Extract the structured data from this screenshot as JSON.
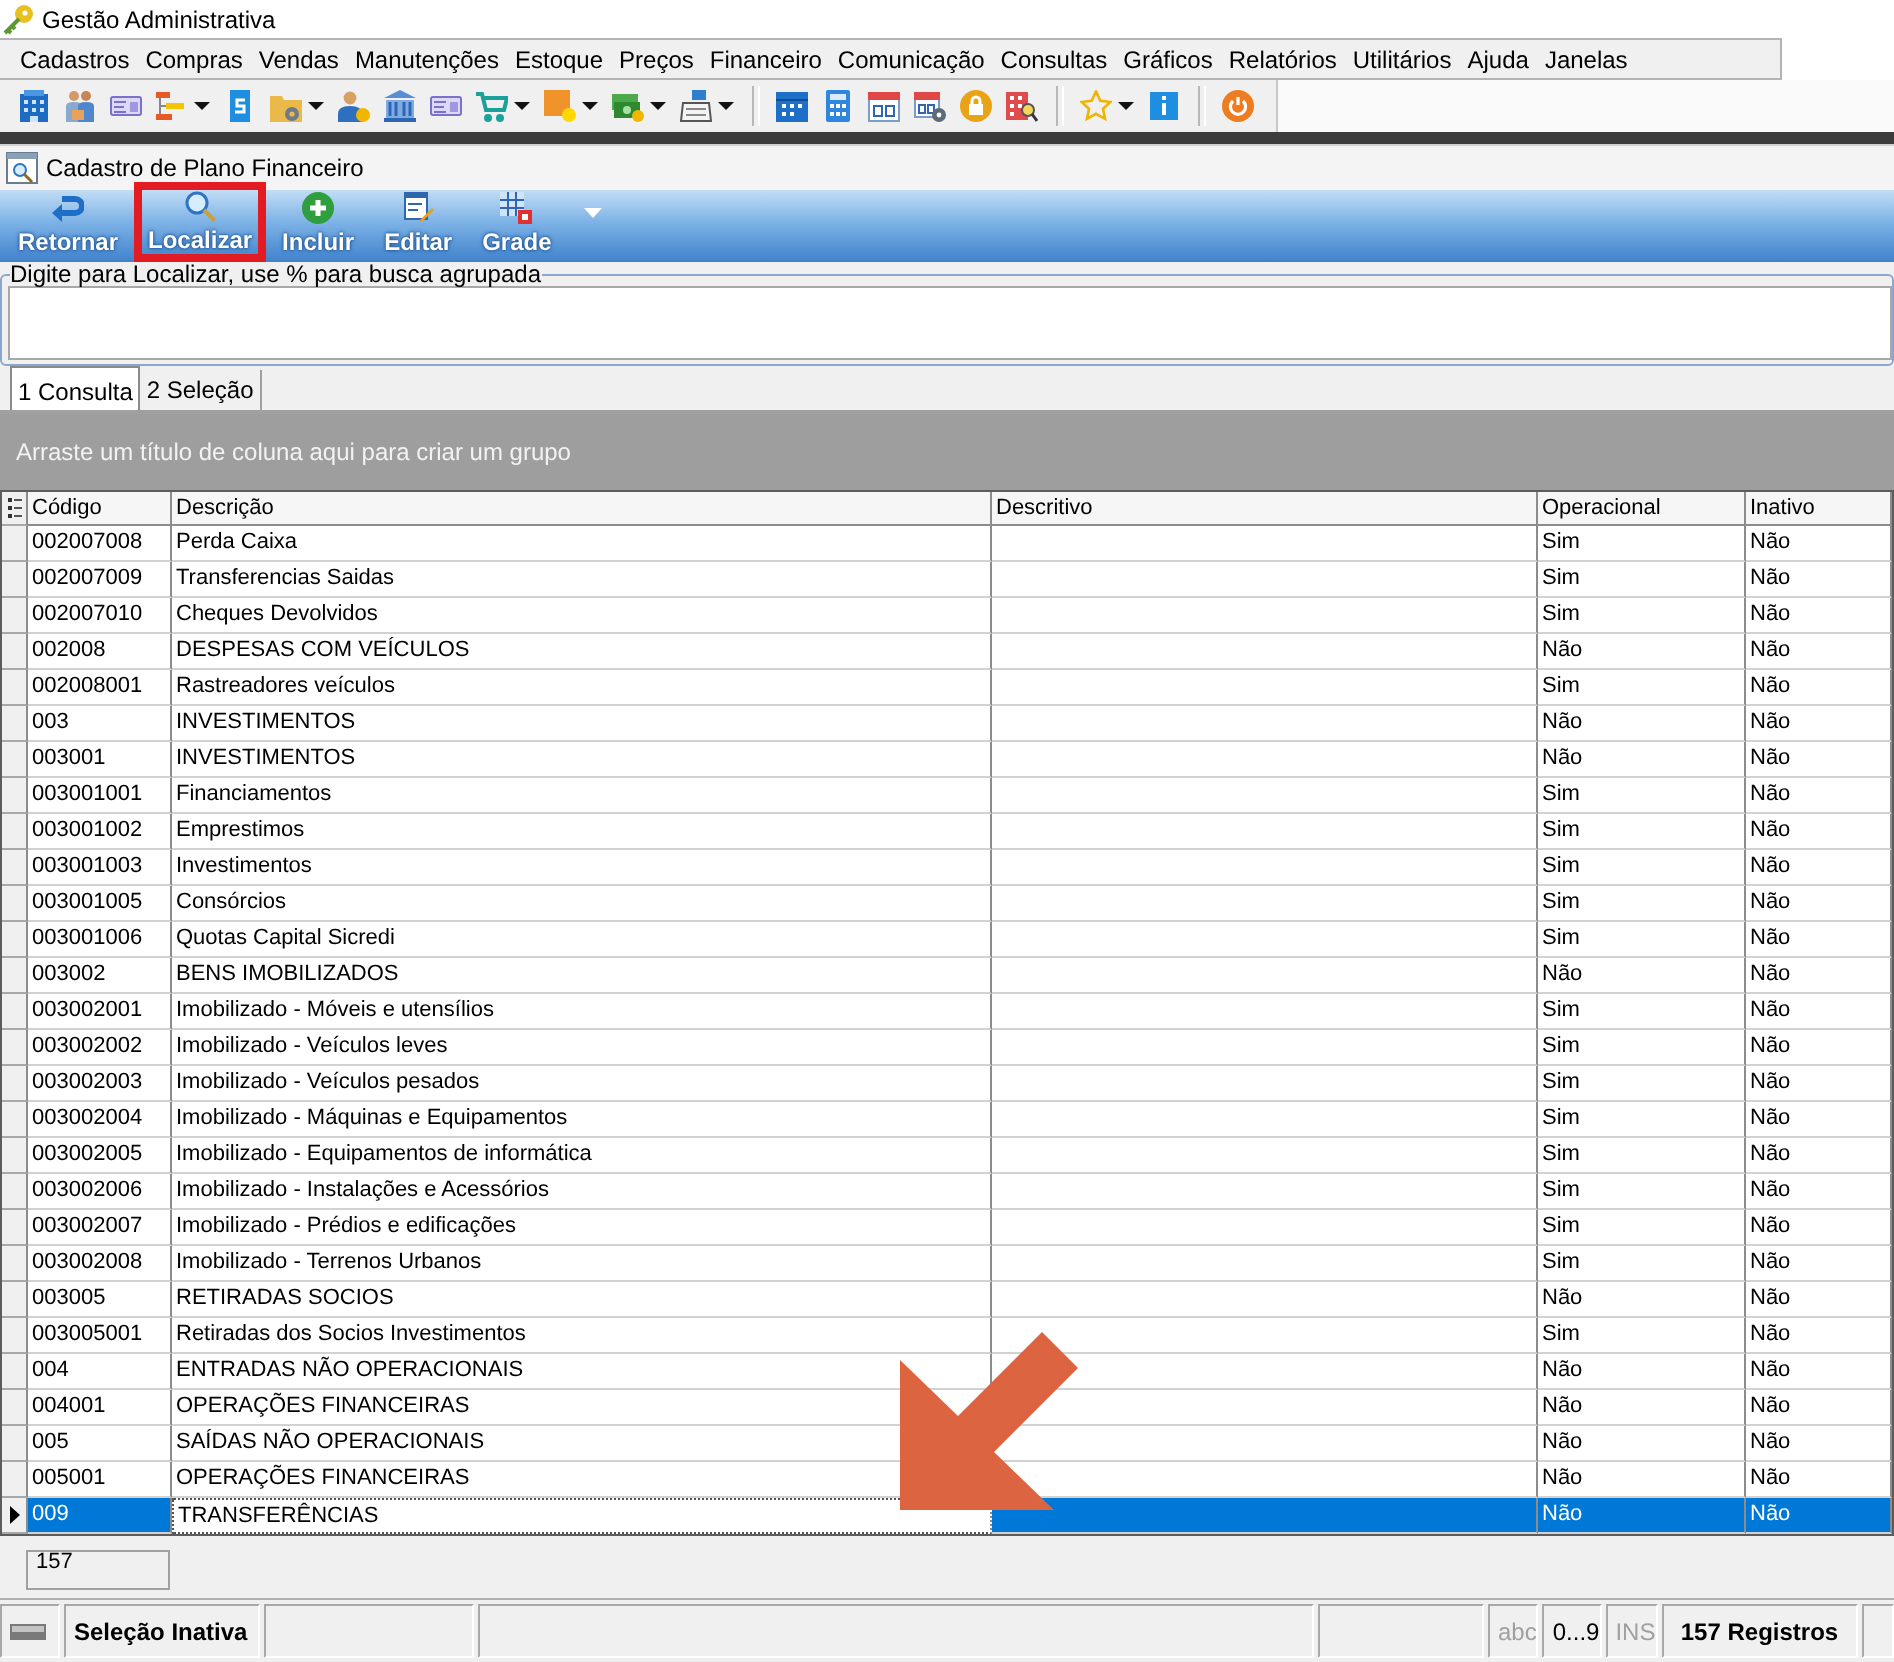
{
  "window": {
    "title": "Gestão Administrativa"
  },
  "menu": [
    "Cadastros",
    "Compras",
    "Vendas",
    "Manutenções",
    "Estoque",
    "Preços",
    "Financeiro",
    "Comunicação",
    "Consultas",
    "Gráficos",
    "Relatórios",
    "Utilitários",
    "Ajuda",
    "Janelas"
  ],
  "main_toolbar": {
    "groups": [
      {
        "tools": [
          {
            "dropdown": false
          },
          {
            "dropdown": false
          },
          {
            "dropdown": false
          },
          {
            "dropdown": true
          },
          {
            "dropdown": false
          },
          {
            "dropdown": true
          },
          {
            "dropdown": false
          },
          {
            "dropdown": false
          },
          {
            "dropdown": false
          },
          {
            "dropdown": true
          },
          {
            "dropdown": true
          },
          {
            "dropdown": true
          },
          {
            "dropdown": true
          }
        ]
      },
      {
        "tools": [
          {
            "dropdown": false
          },
          {
            "dropdown": false
          },
          {
            "dropdown": false
          },
          {
            "dropdown": false
          },
          {
            "dropdown": false
          },
          {
            "dropdown": false
          }
        ]
      },
      {
        "tools": [
          {
            "dropdown": true
          },
          {
            "dropdown": false
          }
        ]
      },
      {
        "tools": [
          {
            "dropdown": false
          }
        ]
      }
    ]
  },
  "form": {
    "title": "Cadastro de Plano Financeiro"
  },
  "form_toolbar": {
    "buttons": [
      {
        "label": "Retornar",
        "highlighted": false
      },
      {
        "label": "Localizar",
        "highlighted": true
      },
      {
        "label": "Incluir",
        "highlighted": false
      },
      {
        "label": "Editar",
        "highlighted": false
      },
      {
        "label": "Grade",
        "highlighted": false
      }
    ]
  },
  "search": {
    "label": "Digite para Localizar, use % para busca agrupada"
  },
  "tabs": [
    {
      "label": "1 Consulta",
      "selected": true
    },
    {
      "label": "2 Seleção",
      "selected": false
    }
  ],
  "group_panel": {
    "hint": "Arraste um título de coluna aqui para criar um grupo"
  },
  "grid": {
    "columns": [
      {
        "label": "Código",
        "focused": false
      },
      {
        "label": "Descrição",
        "focused": true
      },
      {
        "label": "Descritivo",
        "focused": false
      },
      {
        "label": "Operacional",
        "focused": false
      },
      {
        "label": "Inativo",
        "focused": false
      }
    ],
    "rows": [
      {
        "code": "002007008",
        "description": "Perda Caixa",
        "operational": "Sim",
        "inactive": "Não",
        "selected": false
      },
      {
        "code": "002007009",
        "description": "Transferencias Saidas",
        "operational": "Sim",
        "inactive": "Não",
        "selected": false
      },
      {
        "code": "002007010",
        "description": "Cheques Devolvidos",
        "operational": "Sim",
        "inactive": "Não",
        "selected": false
      },
      {
        "code": "002008",
        "description": "DESPESAS COM VEÍCULOS",
        "operational": "Não",
        "inactive": "Não",
        "selected": false
      },
      {
        "code": "002008001",
        "description": "Rastreadores veículos",
        "operational": "Sim",
        "inactive": "Não",
        "selected": false
      },
      {
        "code": "003",
        "description": "INVESTIMENTOS",
        "operational": "Não",
        "inactive": "Não",
        "selected": false
      },
      {
        "code": "003001",
        "description": "INVESTIMENTOS",
        "operational": "Não",
        "inactive": "Não",
        "selected": false
      },
      {
        "code": "003001001",
        "description": "Financiamentos",
        "operational": "Sim",
        "inactive": "Não",
        "selected": false
      },
      {
        "code": "003001002",
        "description": "Emprestimos",
        "operational": "Sim",
        "inactive": "Não",
        "selected": false
      },
      {
        "code": "003001003",
        "description": "Investimentos",
        "operational": "Sim",
        "inactive": "Não",
        "selected": false
      },
      {
        "code": "003001005",
        "description": "Consórcios",
        "operational": "Sim",
        "inactive": "Não",
        "selected": false
      },
      {
        "code": "003001006",
        "description": "Quotas Capital Sicredi",
        "operational": "Sim",
        "inactive": "Não",
        "selected": false
      },
      {
        "code": "003002",
        "description": "BENS IMOBILIZADOS",
        "operational": "Não",
        "inactive": "Não",
        "selected": false
      },
      {
        "code": "003002001",
        "description": "Imobilizado - Móveis e utensílios",
        "operational": "Sim",
        "inactive": "Não",
        "selected": false
      },
      {
        "code": "003002002",
        "description": "Imobilizado - Veículos leves",
        "operational": "Sim",
        "inactive": "Não",
        "selected": false
      },
      {
        "code": "003002003",
        "description": "Imobilizado - Veículos pesados",
        "operational": "Sim",
        "inactive": "Não",
        "selected": false
      },
      {
        "code": "003002004",
        "description": "Imobilizado - Máquinas e Equipamentos",
        "operational": "Sim",
        "inactive": "Não",
        "selected": false
      },
      {
        "code": "003002005",
        "description": "Imobilizado - Equipamentos de informática",
        "operational": "Sim",
        "inactive": "Não",
        "selected": false
      },
      {
        "code": "003002006",
        "description": "Imobilizado - Instalações e Acessórios",
        "operational": "Sim",
        "inactive": "Não",
        "selected": false
      },
      {
        "code": "003002007",
        "description": "Imobilizado - Prédios e edificações",
        "operational": "Sim",
        "inactive": "Não",
        "selected": false
      },
      {
        "code": "003002008",
        "description": "Imobilizado - Terrenos Urbanos",
        "operational": "Sim",
        "inactive": "Não",
        "selected": false
      },
      {
        "code": "003005",
        "description": "RETIRADAS SOCIOS",
        "operational": "Não",
        "inactive": "Não",
        "selected": false
      },
      {
        "code": "003005001",
        "description": "Retiradas dos Socios Investimentos",
        "operational": "Sim",
        "inactive": "Não",
        "selected": false
      },
      {
        "code": "004",
        "description": "ENTRADAS NÃO OPERACIONAIS",
        "operational": "Não",
        "inactive": "Não",
        "selected": false
      },
      {
        "code": "004001",
        "description": "OPERAÇÕES FINANCEIRAS",
        "operational": "Não",
        "inactive": "Não",
        "selected": false
      },
      {
        "code": "005",
        "description": "SAÍDAS NÃO OPERACIONAIS",
        "operational": "Não",
        "inactive": "Não",
        "selected": false
      },
      {
        "code": "005001",
        "description": "OPERAÇÕES FINANCEIRAS",
        "operational": "Não",
        "inactive": "Não",
        "selected": false
      },
      {
        "code": "009",
        "description": "TRANSFERÊNCIAS",
        "operational": "Não",
        "inactive": "Não",
        "selected": true
      }
    ],
    "footer_count": "157"
  },
  "status_bar": {
    "selection": "Seleção Inativa",
    "indicators": [
      {
        "text": "abc",
        "enabled": false
      },
      {
        "text": "0...9",
        "enabled": true
      },
      {
        "text": "INS",
        "enabled": false
      }
    ],
    "record_count": "157 Registros"
  }
}
